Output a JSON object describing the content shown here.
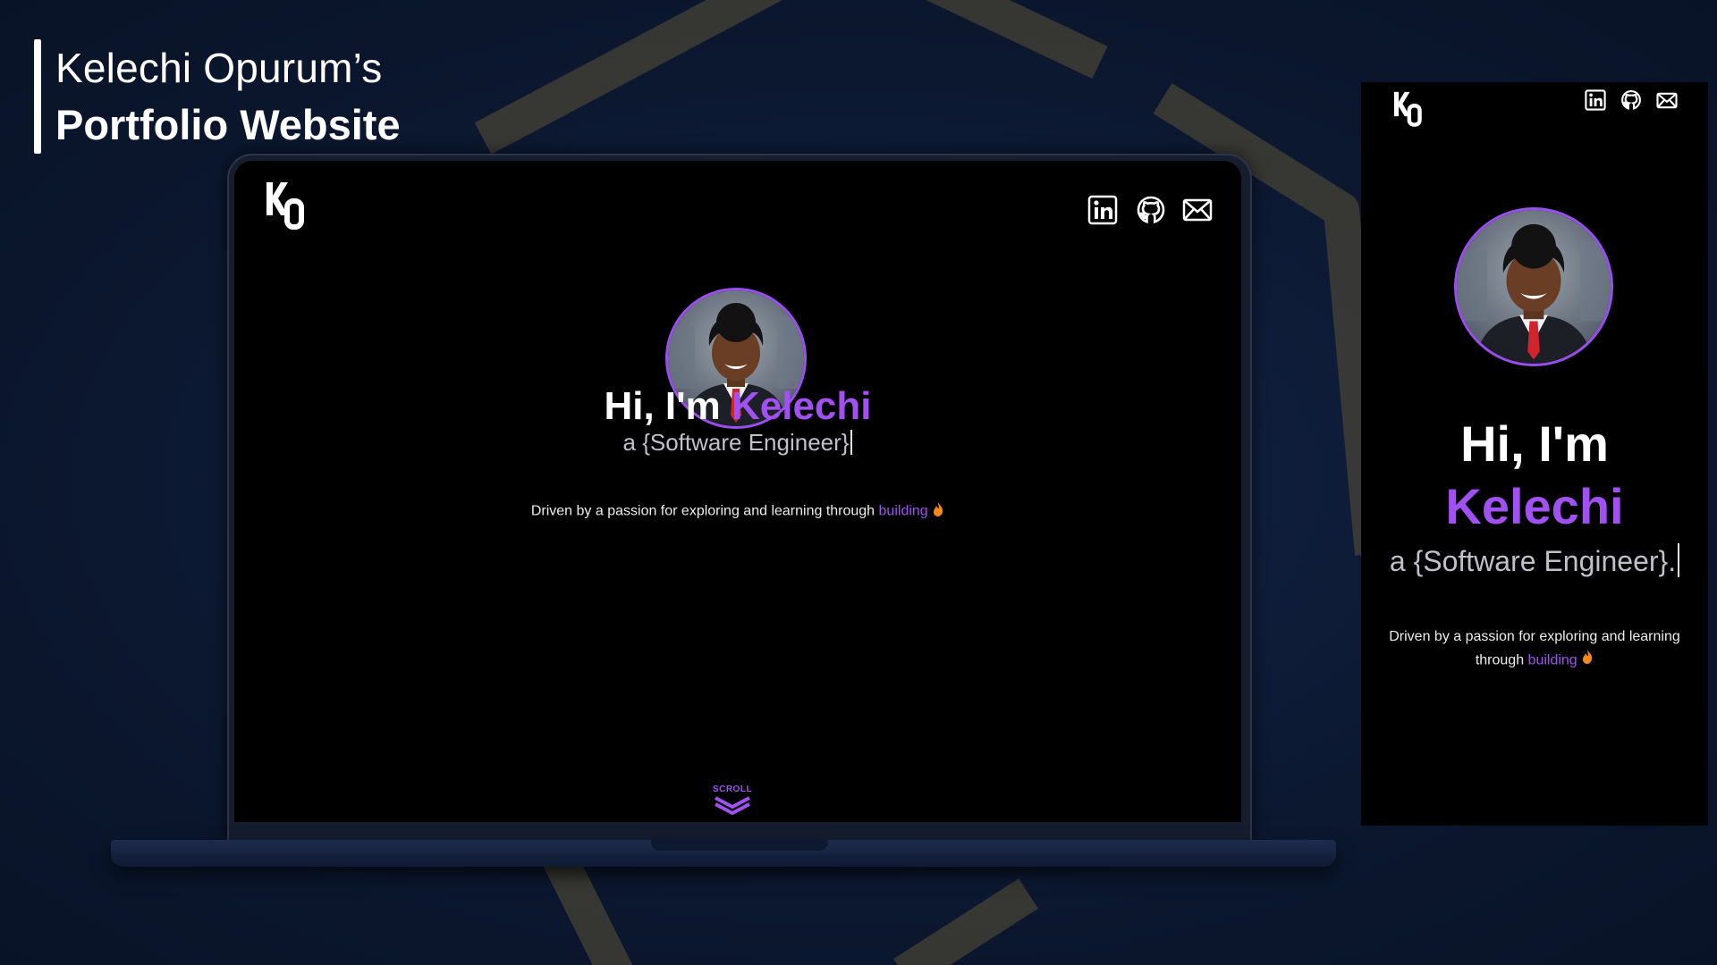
{
  "header": {
    "line1": "Kelechi Opurum’s",
    "line2": "Portfolio Website"
  },
  "site": {
    "logo": "KO",
    "nav_icons": [
      "linkedin-icon",
      "github-icon",
      "mail-icon"
    ],
    "greeting": "Hi, I'm",
    "name": "Kelechi",
    "role_desktop": "a {Software Engineer}",
    "role_mobile": "a {Software Engineer}.",
    "tagline": "Driven by a passion for exploring and learning through",
    "tagline_accent": "building",
    "tagline_mobile_line1": "Driven by a passion for exploring and learning",
    "tagline_mobile_line2": "through",
    "scroll_label": "SCROLL"
  },
  "colors": {
    "accent": "#a150f2",
    "background": "#0d1a36",
    "site_background": "#000000",
    "flame": "#f28a1e"
  }
}
